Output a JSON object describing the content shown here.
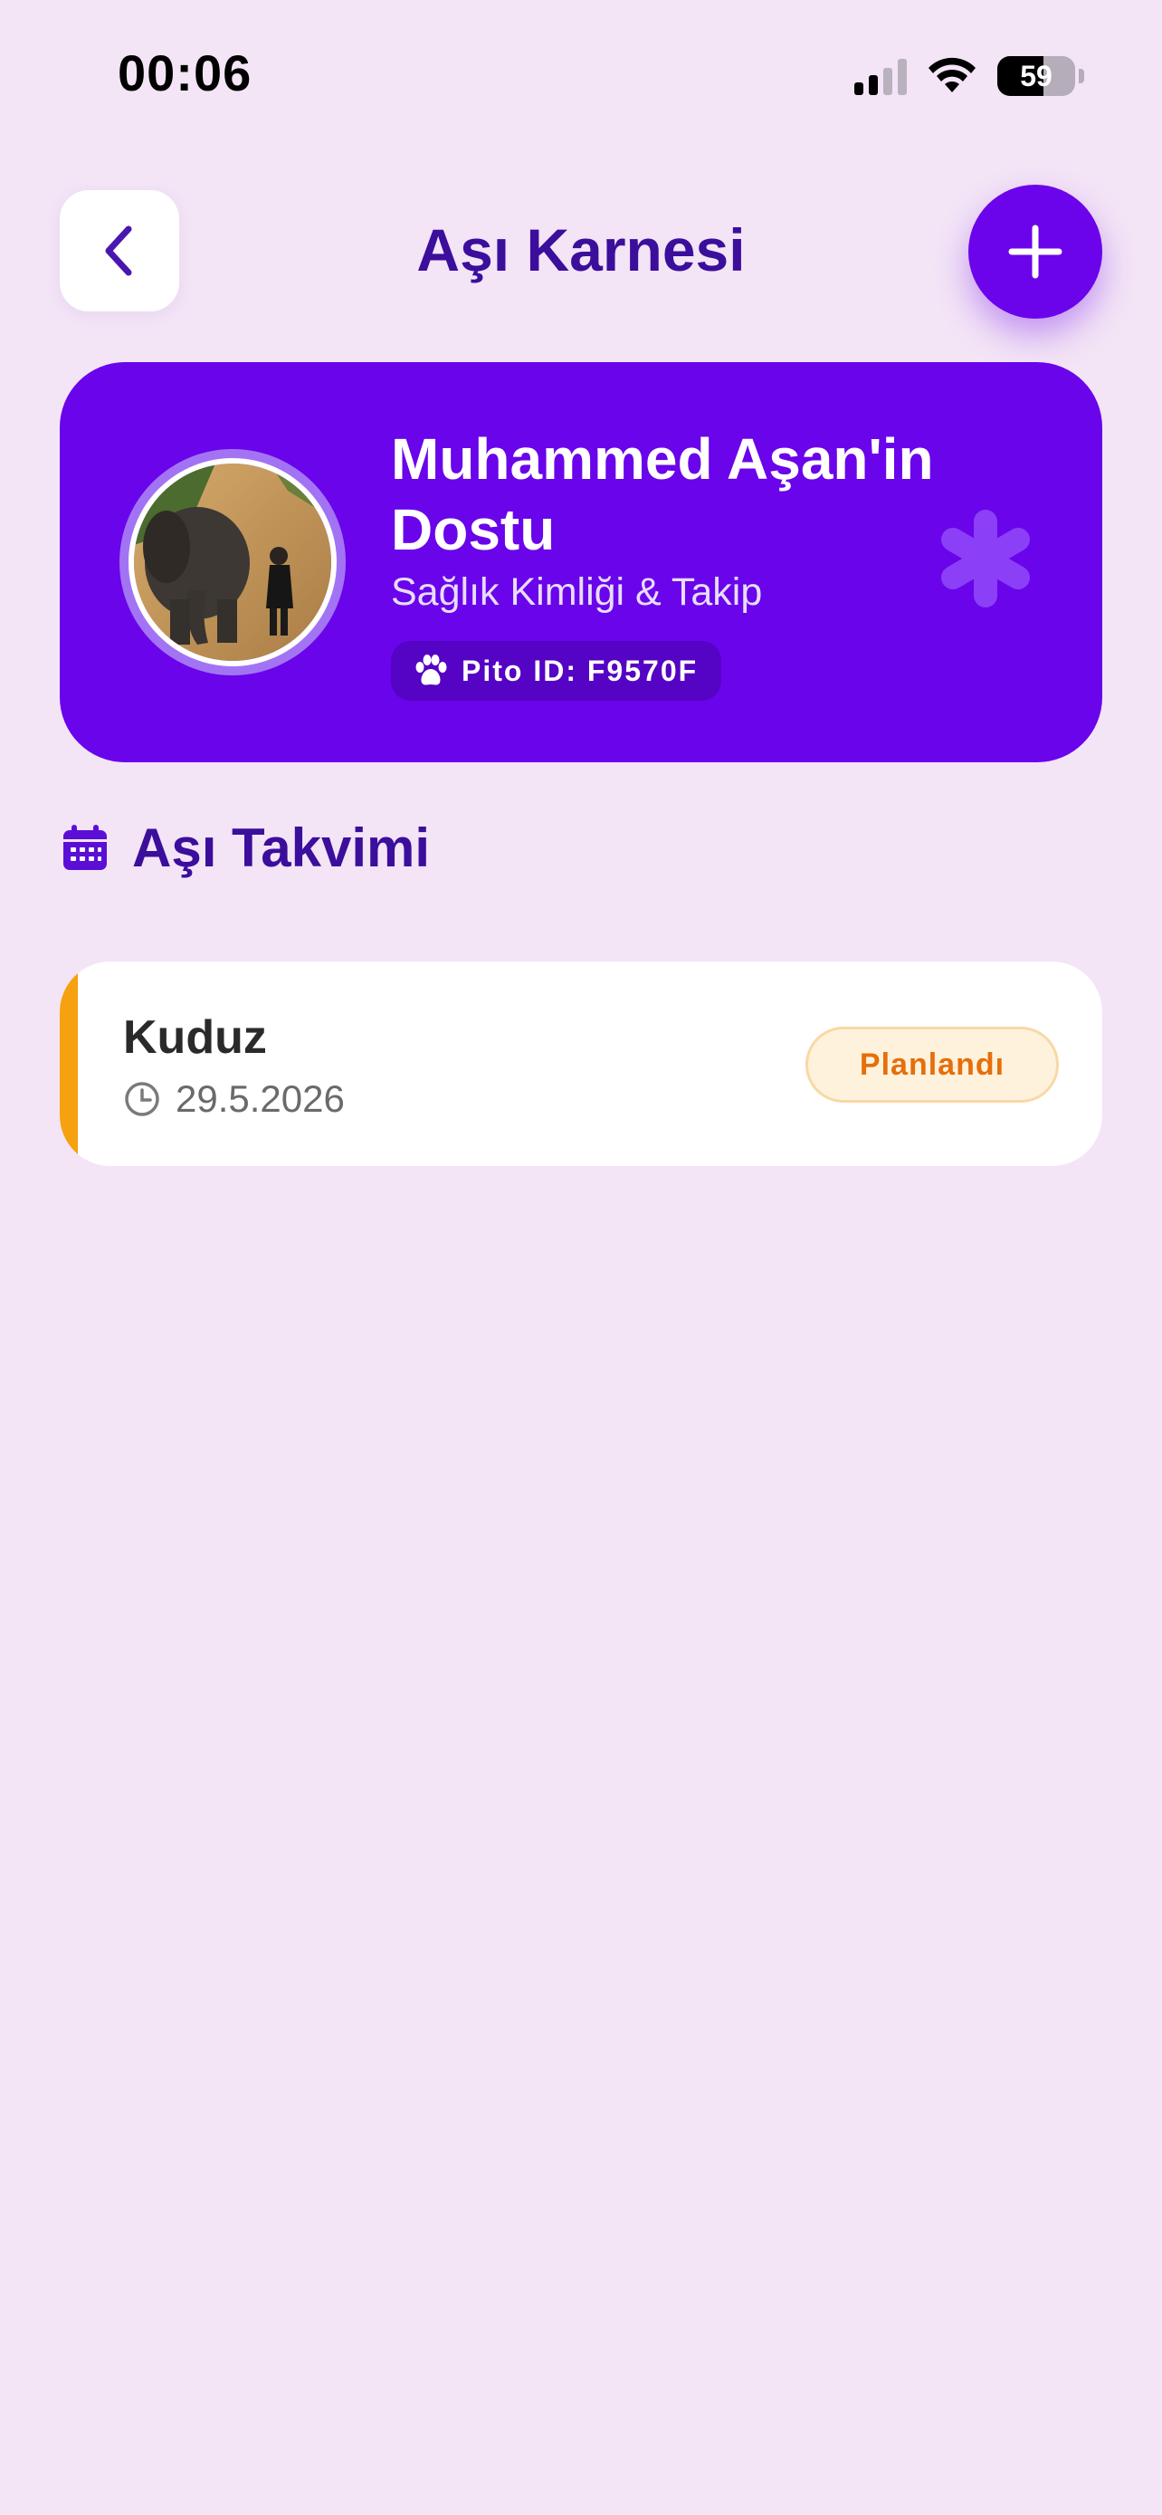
{
  "status_bar": {
    "time": "00:06",
    "battery_percent": "59",
    "battery_level": 0.59,
    "signal_bars_active": 2,
    "icons": [
      "signal-icon",
      "wifi-icon",
      "battery-icon"
    ]
  },
  "header": {
    "title": "Aşı Karnesi",
    "back_icon": "chevron-left-icon",
    "add_icon": "plus-icon"
  },
  "profile": {
    "name": "Muhammed Aşan'in Dostu",
    "subtitle": "Sağlık Kimliği & Takip",
    "pito_id": "Pito ID: F9570F",
    "id_icon": "paw-icon",
    "decoration_icon": "asterisk-icon"
  },
  "section": {
    "title": "Aşı Takvimi",
    "icon": "calendar-icon"
  },
  "vaccines": [
    {
      "name": "Kuduz",
      "date": "29.5.2026",
      "date_icon": "clock-icon",
      "status": "Planlandı",
      "accent_color": "#f6a10f"
    }
  ],
  "colors": {
    "background": "#f3e4f6",
    "primary": "#6a04ea",
    "title": "#3b0e9c",
    "badge_text": "#e56f0b",
    "badge_bg": "#fff2dc"
  }
}
